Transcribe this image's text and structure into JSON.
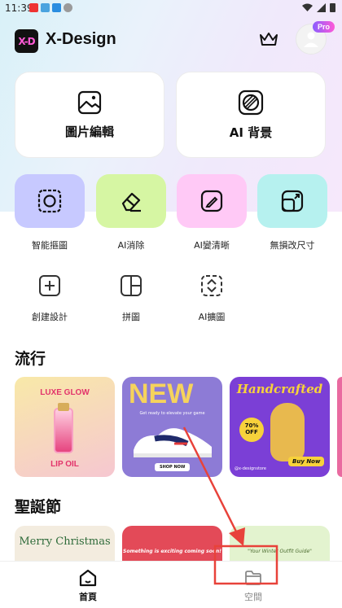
{
  "status_bar": {
    "time": "11:39"
  },
  "header": {
    "app_name": "X-Design",
    "logo_text": "X-D",
    "pro_badge": "Pro"
  },
  "main_cards": [
    {
      "label": "圖片編輯",
      "icon": "image-icon"
    },
    {
      "label": "AI 背景",
      "icon": "ai-background-icon"
    }
  ],
  "tools_primary": [
    {
      "label": "智能摳圖",
      "icon": "smart-cutout-icon",
      "color": "#c7c9ff"
    },
    {
      "label": "AI消除",
      "icon": "eraser-icon",
      "color": "#d6f6a3"
    },
    {
      "label": "AI變清晰",
      "icon": "enhance-icon",
      "color": "#ffc9f6"
    },
    {
      "label": "無損改尺寸",
      "icon": "resize-icon",
      "color": "#b6f1ef"
    }
  ],
  "tools_secondary": [
    {
      "label": "創建設計",
      "icon": "plus-square-icon"
    },
    {
      "label": "拼圖",
      "icon": "collage-icon"
    },
    {
      "label": "AI擴圖",
      "icon": "expand-icon"
    }
  ],
  "sections": {
    "trending": {
      "title": "流行",
      "thumbnails": [
        {
          "top_text": "LUXE GLOW",
          "bottom_text": "LIP OIL"
        },
        {
          "title": "NEW",
          "sub": "Get ready to elevate your game",
          "cta": "SHOP NOW"
        },
        {
          "title": "Handcrafted",
          "badge_pct": "70%",
          "badge_off": "OFF",
          "handle": "@x-designstore",
          "cta": "Buy Now"
        }
      ]
    },
    "christmas": {
      "title": "聖誕節",
      "thumbnails": [
        {
          "title": "Merry Christmas"
        },
        {
          "title": "Something is exciting coming soon!"
        },
        {
          "title": "\"Your Winter Outfit Guide\""
        }
      ]
    }
  },
  "bottom_nav": [
    {
      "label": "首頁",
      "icon": "home-icon",
      "active": true
    },
    {
      "label": "空間",
      "icon": "folder-icon",
      "active": false
    }
  ],
  "colors": {
    "accent_lime": "#d6ff3b",
    "accent_pink": "#ff5ad7",
    "annotation_red": "#e8423a"
  }
}
